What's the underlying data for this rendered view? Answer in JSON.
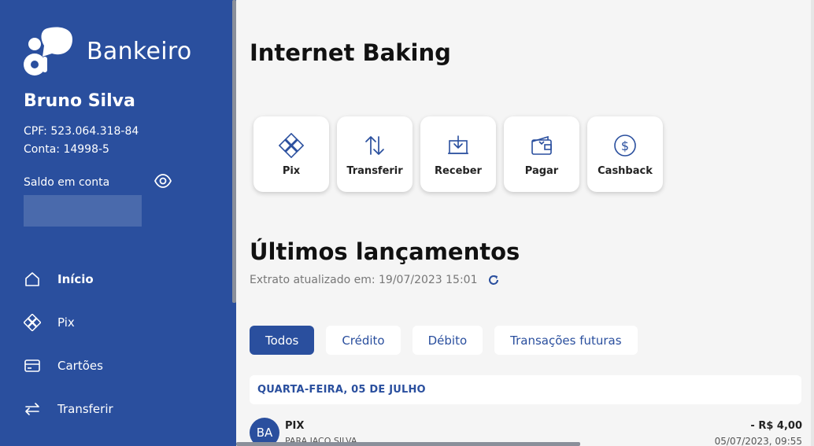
{
  "brand": {
    "name": "Bankeiro",
    "logo_icon": "bankeiro-logo"
  },
  "user": {
    "name": "Bruno Silva",
    "cpf": "CPF: 523.064.318-84",
    "conta": "Conta: 14998-5",
    "saldo_label": "Saldo em conta"
  },
  "sidebar": {
    "items": [
      {
        "label": "Início",
        "icon": "home-icon",
        "active": true
      },
      {
        "label": "Pix",
        "icon": "pix-icon"
      },
      {
        "label": "Cartões",
        "icon": "card-icon"
      },
      {
        "label": "Transferir",
        "icon": "transfer-icon"
      }
    ]
  },
  "main": {
    "title": "Internet Baking",
    "actions": [
      {
        "label": "Pix",
        "icon": "pix-icon"
      },
      {
        "label": "Transferir",
        "icon": "arrows-up-down-icon"
      },
      {
        "label": "Receber",
        "icon": "receive-icon"
      },
      {
        "label": "Pagar",
        "icon": "wallet-icon"
      },
      {
        "label": "Cashback",
        "icon": "dollar-coin-icon"
      }
    ],
    "section_title": "Últimos lançamentos",
    "updated_text": "Extrato atualizado em: 19/07/2023 15:01",
    "filters": [
      {
        "label": "Todos",
        "active": true
      },
      {
        "label": "Crédito"
      },
      {
        "label": "Débito"
      },
      {
        "label": "Transações futuras"
      }
    ],
    "day_header": "QUARTA-FEIRA, 05 DE JULHO",
    "transactions": [
      {
        "avatar": "BA",
        "type": "PIX",
        "description": "PARA JACO SILVA",
        "amount": "- R$ 4,00",
        "date": "05/07/2023, 09:55"
      }
    ]
  },
  "colors": {
    "primary": "#2a4f9e",
    "background": "#f5f5f5"
  }
}
